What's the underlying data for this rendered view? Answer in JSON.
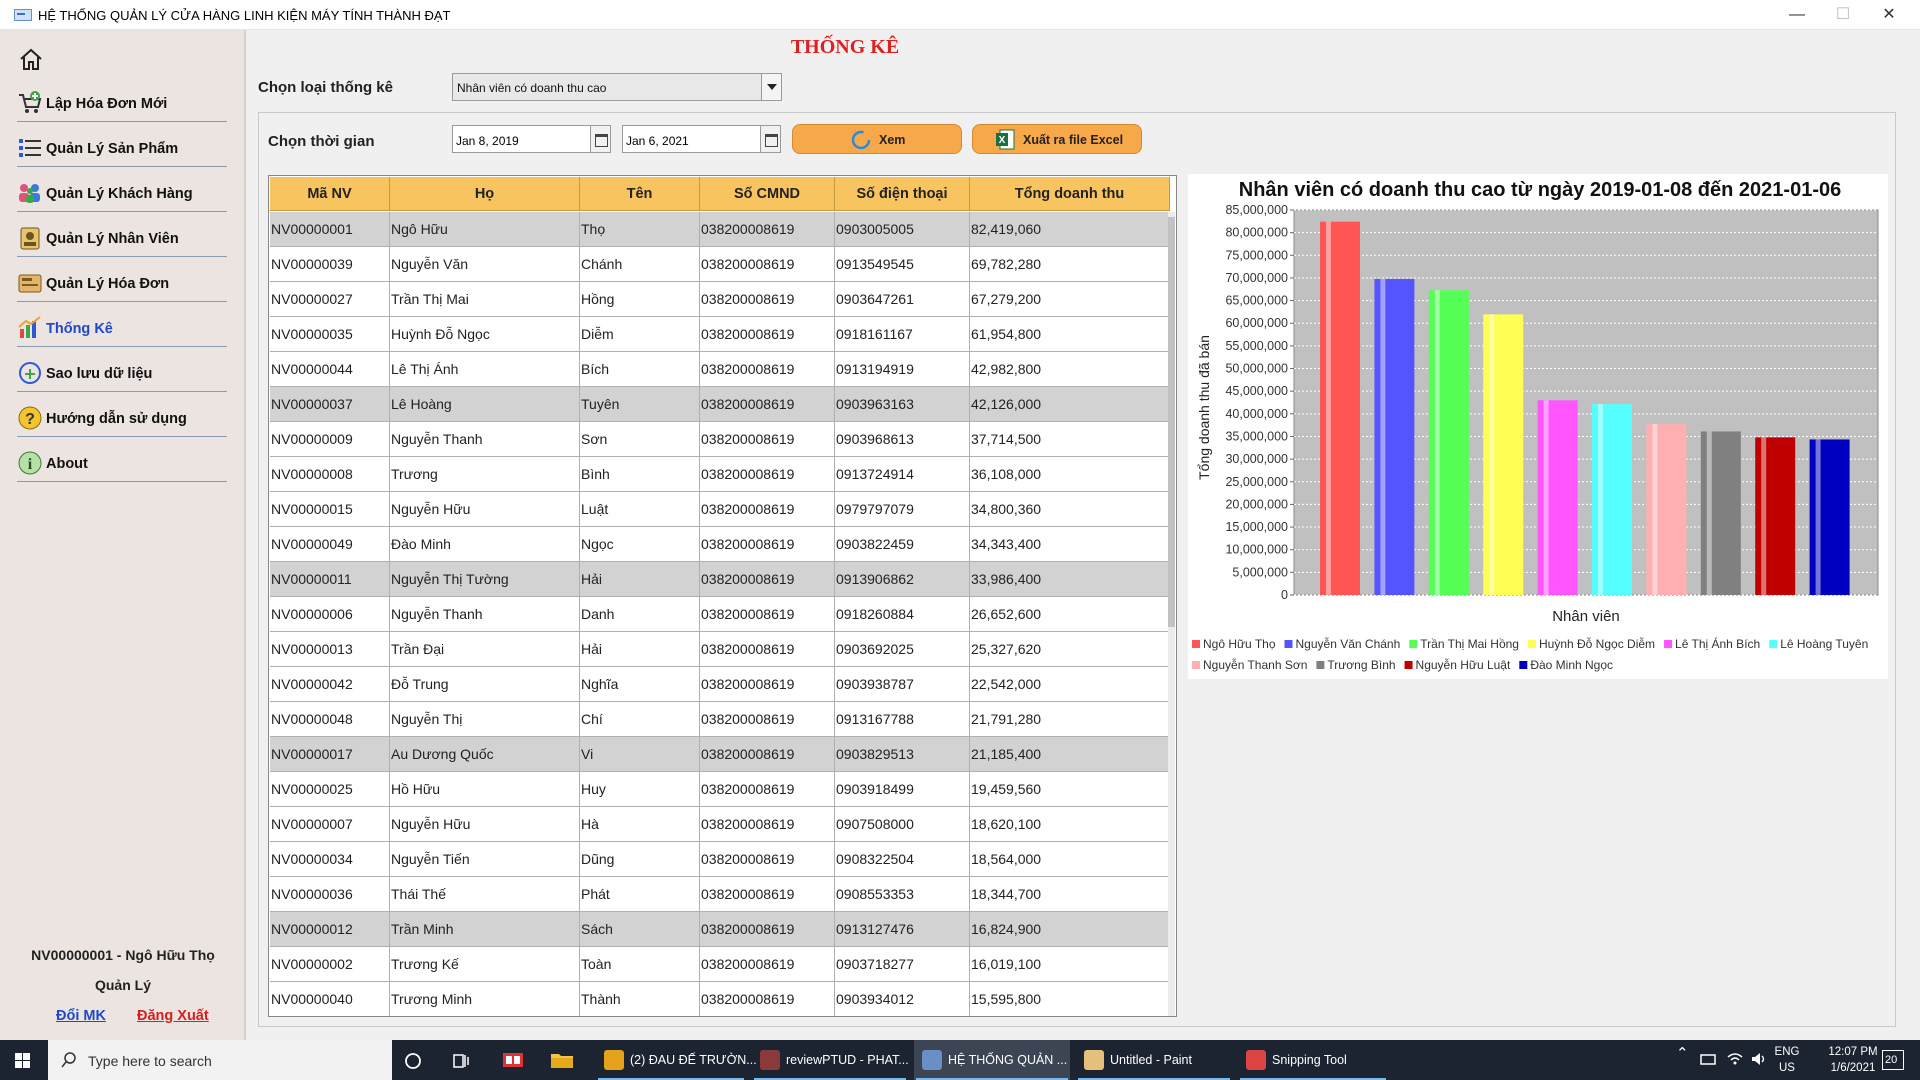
{
  "window": {
    "title": "HỆ THỐNG QUẢN LÝ CỬA HÀNG LINH KIỆN MÁY TÍNH THÀNH ĐẠT",
    "minimize": "—",
    "maximize": "☐",
    "close": "✕"
  },
  "sidebar": {
    "items": [
      {
        "label": "Lập Hóa Đơn Mới",
        "icon": "cart-add-icon"
      },
      {
        "label": "Quản Lý Sản Phẩm",
        "icon": "list-icon"
      },
      {
        "label": "Quản Lý Khách Hàng",
        "icon": "customers-icon"
      },
      {
        "label": "Quản Lý Nhân Viên",
        "icon": "employee-badge-icon"
      },
      {
        "label": "Quản Lý Hóa Đơn",
        "icon": "bill-icon"
      },
      {
        "label": "Thống Kê",
        "icon": "bar-chart-icon"
      },
      {
        "label": "Sao lưu dữ liệu",
        "icon": "backup-icon"
      },
      {
        "label": "Hướng dẫn sử dụng",
        "icon": "help-icon"
      },
      {
        "label": "About",
        "icon": "info-icon"
      }
    ],
    "user": "NV00000001 - Ngô Hữu  Thọ",
    "role": "Quản Lý",
    "change_password": "Đổi MK",
    "logout": "Đăng Xuất"
  },
  "main": {
    "title": "THỐNG KÊ",
    "type_label": "Chọn loại thống kê",
    "type_value": "Nhân viên có doanh thu cao",
    "time_label": "Chọn thời gian",
    "date_from": "Jan 8, 2019",
    "date_to": "Jan 6, 2021",
    "view_button": "Xem",
    "excel_button": "Xuất ra file Excel"
  },
  "table": {
    "columns": [
      "Mã NV",
      "Họ",
      "Tên",
      "Số CMND",
      "Số điện thoại",
      "Tổng doanh thu"
    ],
    "rows": [
      {
        "id": "NV00000001",
        "ho": "Ngô Hữu",
        "ten": "Thọ",
        "cmnd": "038200008619",
        "phone": "0903005005",
        "total": "82,419,060",
        "gray": true
      },
      {
        "id": "NV00000039",
        "ho": "Nguyễn Văn",
        "ten": "Chánh",
        "cmnd": "038200008619",
        "phone": "0913549545",
        "total": "69,782,280",
        "gray": false
      },
      {
        "id": "NV00000027",
        "ho": "Trần Thị Mai",
        "ten": "Hồng",
        "cmnd": "038200008619",
        "phone": "0903647261",
        "total": "67,279,200",
        "gray": false
      },
      {
        "id": "NV00000035",
        "ho": "Huỳnh Đỗ Ngọc",
        "ten": "Diễm",
        "cmnd": "038200008619",
        "phone": "0918161167",
        "total": "61,954,800",
        "gray": false
      },
      {
        "id": "NV00000044",
        "ho": "Lê Thị Ánh",
        "ten": "Bích",
        "cmnd": "038200008619",
        "phone": "0913194919",
        "total": "42,982,800",
        "gray": false
      },
      {
        "id": "NV00000037",
        "ho": "Lê Hoàng",
        "ten": "Tuyên",
        "cmnd": "038200008619",
        "phone": "0903963163",
        "total": "42,126,000",
        "gray": true
      },
      {
        "id": "NV00000009",
        "ho": "Nguyễn Thanh",
        "ten": "Sơn",
        "cmnd": "038200008619",
        "phone": "0903968613",
        "total": "37,714,500",
        "gray": false
      },
      {
        "id": "NV00000008",
        "ho": "Trương",
        "ten": "Bình",
        "cmnd": "038200008619",
        "phone": "0913724914",
        "total": "36,108,000",
        "gray": false
      },
      {
        "id": "NV00000015",
        "ho": "Nguyễn Hữu",
        "ten": "Luật",
        "cmnd": "038200008619",
        "phone": "0979797079",
        "total": "34,800,360",
        "gray": false
      },
      {
        "id": "NV00000049",
        "ho": "Đào Minh",
        "ten": "Ngọc",
        "cmnd": "038200008619",
        "phone": "0903822459",
        "total": "34,343,400",
        "gray": false
      },
      {
        "id": "NV00000011",
        "ho": "Nguyễn Thị Tường",
        "ten": "Hải",
        "cmnd": "038200008619",
        "phone": "0913906862",
        "total": "33,986,400",
        "gray": true
      },
      {
        "id": "NV00000006",
        "ho": "Nguyễn Thanh",
        "ten": "Danh",
        "cmnd": "038200008619",
        "phone": "0918260884",
        "total": "26,652,600",
        "gray": false
      },
      {
        "id": "NV00000013",
        "ho": "Trần Đại",
        "ten": "Hải",
        "cmnd": "038200008619",
        "phone": "0903692025",
        "total": "25,327,620",
        "gray": false
      },
      {
        "id": "NV00000042",
        "ho": "Đỗ Trung",
        "ten": "Nghĩa",
        "cmnd": "038200008619",
        "phone": "0903938787",
        "total": "22,542,000",
        "gray": false
      },
      {
        "id": "NV00000048",
        "ho": "Nguyễn Thị",
        "ten": "Chí",
        "cmnd": "038200008619",
        "phone": "0913167788",
        "total": "21,791,280",
        "gray": false
      },
      {
        "id": "NV00000017",
        "ho": "Au Dương Quốc",
        "ten": "Vi",
        "cmnd": "038200008619",
        "phone": "0903829513",
        "total": "21,185,400",
        "gray": true
      },
      {
        "id": "NV00000025",
        "ho": "Hồ Hữu",
        "ten": "Huy",
        "cmnd": "038200008619",
        "phone": "0903918499",
        "total": "19,459,560",
        "gray": false
      },
      {
        "id": "NV00000007",
        "ho": "Nguyễn Hữu",
        "ten": "Hà",
        "cmnd": "038200008619",
        "phone": "0907508000",
        "total": "18,620,100",
        "gray": false
      },
      {
        "id": "NV00000034",
        "ho": "Nguyễn Tiến",
        "ten": "Dũng",
        "cmnd": "038200008619",
        "phone": "0908322504",
        "total": "18,564,000",
        "gray": false
      },
      {
        "id": "NV00000036",
        "ho": "Thái Thế",
        "ten": "Phát",
        "cmnd": "038200008619",
        "phone": "0908553353",
        "total": "18,344,700",
        "gray": false
      },
      {
        "id": "NV00000012",
        "ho": "Trần Minh",
        "ten": "Sách",
        "cmnd": "038200008619",
        "phone": "0913127476",
        "total": "16,824,900",
        "gray": true
      },
      {
        "id": "NV00000002",
        "ho": "Trương Kế",
        "ten": "Toàn",
        "cmnd": "038200008619",
        "phone": "0903718277",
        "total": "16,019,100",
        "gray": false
      },
      {
        "id": "NV00000040",
        "ho": "Trương Minh",
        "ten": "Thành",
        "cmnd": "038200008619",
        "phone": "0903934012",
        "total": "15,595,800",
        "gray": false
      }
    ]
  },
  "chart_data": {
    "type": "bar",
    "title": "Nhân viên có doanh thu cao từ ngày 2019-01-08 đến 2021-01-06",
    "xlabel": "Nhân viên",
    "ylabel": "Tổng doanh thu đã bán",
    "ylim": [
      0,
      85000000
    ],
    "yticks": [
      "85,000,000",
      "80,000,000",
      "75,000,000",
      "70,000,000",
      "65,000,000",
      "60,000,000",
      "55,000,000",
      "50,000,000",
      "45,000,000",
      "40,000,000",
      "35,000,000",
      "30,000,000",
      "25,000,000",
      "20,000,000",
      "15,000,000",
      "10,000,000",
      "5,000,000",
      "0"
    ],
    "grid": true,
    "legend_position": "bottom",
    "series": [
      {
        "name": "Ngô Hữu  Thọ",
        "value": 82419060,
        "color": "#ff5555"
      },
      {
        "name": "Nguyễn Văn Chánh",
        "value": 69782280,
        "color": "#5555ff"
      },
      {
        "name": "Trần Thị Mai Hồng",
        "value": 67279200,
        "color": "#55ff55"
      },
      {
        "name": "Huỳnh Đỗ Ngọc  Diễm",
        "value": 61954800,
        "color": "#ffff55"
      },
      {
        "name": "Lê Thị Ánh  Bích",
        "value": 42982800,
        "color": "#ff55ff"
      },
      {
        "name": "Lê Hoàng Tuyên",
        "value": 42126000,
        "color": "#55ffff"
      },
      {
        "name": "Nguyễn Thanh Sơn",
        "value": 37714500,
        "color": "#ffafaf"
      },
      {
        "name": "Trương Bình",
        "value": 36108000,
        "color": "#808080"
      },
      {
        "name": "Nguyễn Hữu Luật",
        "value": 34800360,
        "color": "#c00000"
      },
      {
        "name": "Đào Minh Ngọc",
        "value": 34343400,
        "color": "#0000c0"
      }
    ]
  },
  "taskbar": {
    "search_placeholder": "Type here to search",
    "items": [
      {
        "label": "(2) ĐAU ĐẾ TRƯỜN...",
        "color": "#e4a11b"
      },
      {
        "label": "reviewPTUD - PHAT...",
        "color": "#8b3a3a"
      },
      {
        "label": "HỆ THỐNG QUẢN ...",
        "color": "#6a8fc7"
      },
      {
        "label": "Untitled - Paint",
        "color": "#e5c07b"
      },
      {
        "label": "Snipping Tool",
        "color": "#d44"
      }
    ],
    "lang": "ENG",
    "region": "US",
    "time": "12:07 PM",
    "date": "1/6/2021",
    "notifications": "20"
  }
}
